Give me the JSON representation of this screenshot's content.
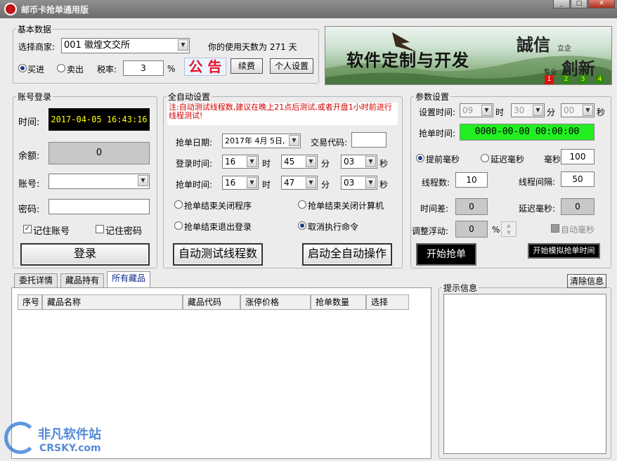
{
  "window": {
    "title": "邮币卡抢单通用版",
    "min_label": "_",
    "max_label": "□",
    "close_label": "✕"
  },
  "basic": {
    "legend": "基本数据",
    "merchant_label": "选择商家:",
    "merchant_value": "001 徽煌文交所",
    "days_text": "你的使用天数为  271  天",
    "buy_label": "买进",
    "sell_label": "卖出",
    "tax_label": "税率:",
    "tax_value": "3",
    "tax_unit": "%",
    "notice_label": "公 告",
    "renew_button": "续费",
    "personal_button": "个人设置"
  },
  "banner": {
    "main_text": "软件定制与开发",
    "honesty": "誠信",
    "honesty_sub": "立企",
    "innovation": "創新",
    "innovation_sub": "专业",
    "boxes": [
      "1",
      "2",
      "3",
      "4"
    ],
    "box_colors": [
      "#e01010",
      "#2a8a1a",
      "#2a8a1a",
      "#2a8a1a"
    ]
  },
  "login": {
    "legend": "账号登录",
    "time_label": "时间:",
    "time_value": "2017-04-05 16:43:16",
    "balance_label": "余额:",
    "balance_value": "0",
    "account_label": "账号:",
    "account_value": "",
    "password_label": "密码:",
    "password_value": "",
    "remember_account": "记住账号",
    "remember_password": "记住密码",
    "login_button": "登录"
  },
  "auto": {
    "legend": "全自动设置",
    "note": "注:自动测试线程数,建议在晚上21点后测试,或者开盘1小时前进行线程测试!",
    "date_label": "抢单日期:",
    "date_value": "2017年 4月 5日,",
    "code_label": "交易代码:",
    "code_value": "",
    "login_time_label": "登录时间:",
    "login_hour": "16",
    "login_min": "45",
    "login_sec": "03",
    "grab_time_label": "抢单时间:",
    "grab_hour": "16",
    "grab_min": "47",
    "grab_sec": "03",
    "hour_unit": "时",
    "min_unit": "分",
    "sec_unit": "秒",
    "opt_close_program": "抢单结束关闭程序",
    "opt_shutdown": "抢单结束关闭计算机",
    "opt_logout": "抢单结束退出登录",
    "opt_cancel": "取消执行命令",
    "test_button": "自动测试线程数",
    "start_button": "启动全自动操作"
  },
  "params": {
    "legend": "参数设置",
    "set_time_label": "设置时间:",
    "set_hour": "09",
    "set_min": "30",
    "set_sec": "00",
    "hour_unit": "时",
    "min_unit": "分",
    "sec_unit": "秒",
    "grab_time_label": "抢单时间:",
    "grab_time_value": "0000-00-00 00:00:00",
    "advance_label": "提前毫秒",
    "delay_label": "延迟毫秒",
    "ms_label": "毫秒",
    "ms_value": "100",
    "threads_label": "线程数:",
    "threads_value": "10",
    "interval_label": "线程间隔:",
    "interval_value": "50",
    "timediff_label": "时间差:",
    "timediff_value": "0",
    "delayms_label": "延迟毫秒:",
    "delayms_value": "0",
    "float_label": "调整浮动:",
    "float_value": "0",
    "float_unit": "%",
    "auto_ms_label": "自动毫秒",
    "start_grab_button": "开始抢单",
    "simulate_button": "开始模拟抢单时间"
  },
  "tabs": [
    "委托详情",
    "藏品持有",
    "所有藏品"
  ],
  "table": {
    "columns": [
      "序号",
      "藏品名称",
      "藏品代码",
      "涨停价格",
      "抢单数量",
      "选择"
    ]
  },
  "info": {
    "legend": "提示信息",
    "clear_button": "清除信息"
  },
  "watermark": {
    "brand": "非凡软件站",
    "site": "CRSKY.com"
  },
  "colors": {
    "time_bg": "#000000",
    "time_fg": "#ffff00",
    "grab_bg": "#22ee22",
    "notice": "#e8102a",
    "note": "#d00000"
  }
}
